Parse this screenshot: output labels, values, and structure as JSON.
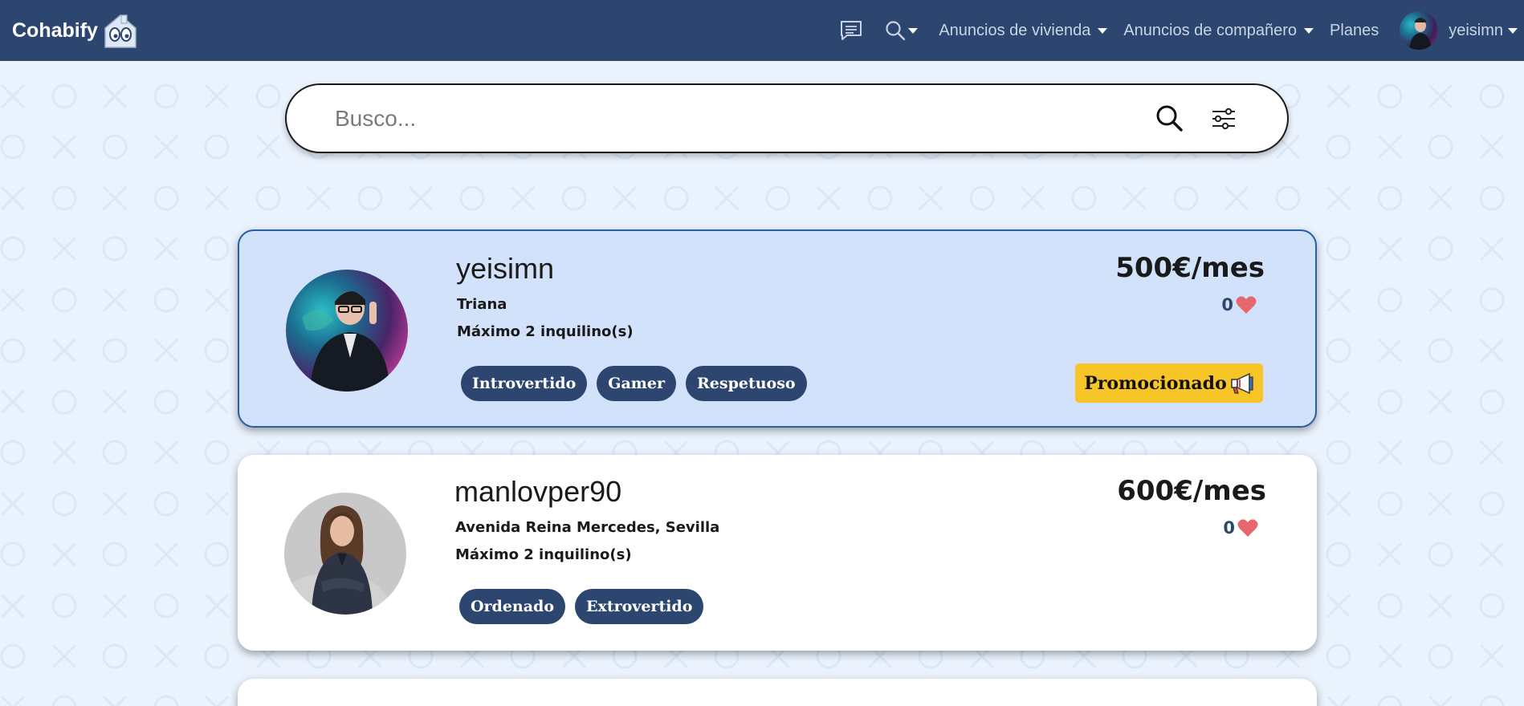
{
  "navbar": {
    "brand": "Cohabify",
    "brand_icon": "house-eyes-logo",
    "messages_icon": "chat-icon",
    "search_icon": "search-icon",
    "menu_housing": "Anuncios de vivienda",
    "menu_roommate": "Anuncios de compañero",
    "plans": "Planes",
    "username": "yeisimn"
  },
  "search": {
    "placeholder": "Busco...",
    "value": "",
    "search_icon": "search-icon",
    "filter_icon": "sliders-icon"
  },
  "listings": [
    {
      "username": "yeisimn",
      "location": "Triana",
      "max_tenants": "Máximo 2 inquilino(s)",
      "price": "500€/mes",
      "likes": "0",
      "tags": [
        "Introvertido",
        "Gamer",
        "Respetuoso"
      ],
      "promoted": true,
      "promo_label": "Promocionado",
      "promo_icon": "megaphone-icon"
    },
    {
      "username": "manlovper90",
      "location": "Avenida Reina Mercedes, Sevilla",
      "max_tenants": "Máximo 2 inquilino(s)",
      "price": "600€/mes",
      "likes": "0",
      "tags": [
        "Ordenado",
        "Extrovertido"
      ],
      "promoted": false
    }
  ],
  "colors": {
    "navbar": "#2c4670",
    "page_background": "#eaf2fd",
    "promoted_card": "#d3e2fb",
    "promo_badge": "#f7c527",
    "tag": "#2c4670",
    "heart": "#e8676f"
  }
}
